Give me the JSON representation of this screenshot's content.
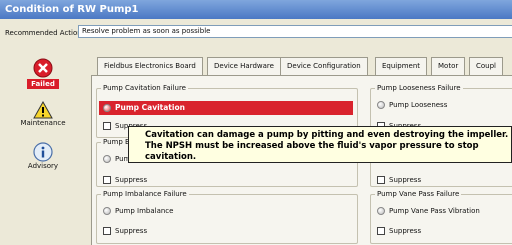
{
  "window": {
    "title": "Condition of RW Pump1"
  },
  "recommended": {
    "label": "Recommended Action:",
    "value": "Resolve problem as soon as possible"
  },
  "statuses": [
    {
      "label": "Failed",
      "icon": "error-icon"
    },
    {
      "label": "Maintenance",
      "icon": "warning-icon"
    },
    {
      "label": "Advisory",
      "icon": "info-icon"
    }
  ],
  "tabs": [
    "Fieldbus Electronics Board",
    "Device Hardware",
    "Device Configuration",
    "Equipment",
    "Motor",
    "Coupl"
  ],
  "groups": {
    "cavitation": {
      "title": "Pump Cavitation Failure",
      "alarm": "Pump Cavitation",
      "suppress": "Suppress"
    },
    "bearing": {
      "title": "Pump B",
      "item": "Pum",
      "suppress": "Suppress"
    },
    "imbalance": {
      "title": "Pump Imbalance Failure",
      "item": "Pump Imbalance",
      "suppress": "Suppress"
    },
    "looseness": {
      "title": "Pump Looseness Failure",
      "item": "Pump Looseness",
      "suppress": "Suppress"
    },
    "vane": {
      "title": "Pump Vane Pass Failure",
      "item": "Pump Vane Pass Vibration",
      "suppress": "Suppress"
    },
    "right_mid": {
      "suppress": "Suppress"
    }
  },
  "tooltip": {
    "line1": "Cavitation can damage a pump by pitting and even destroying the impeller.",
    "line2": "The NPSH must be increased above the fluid's vapor pressure to stop",
    "line3": "cavitation."
  },
  "colors": {
    "title_bar": "#5a86cf",
    "failed": "#d91d2a",
    "tooltip_bg": "#ffffe1"
  }
}
